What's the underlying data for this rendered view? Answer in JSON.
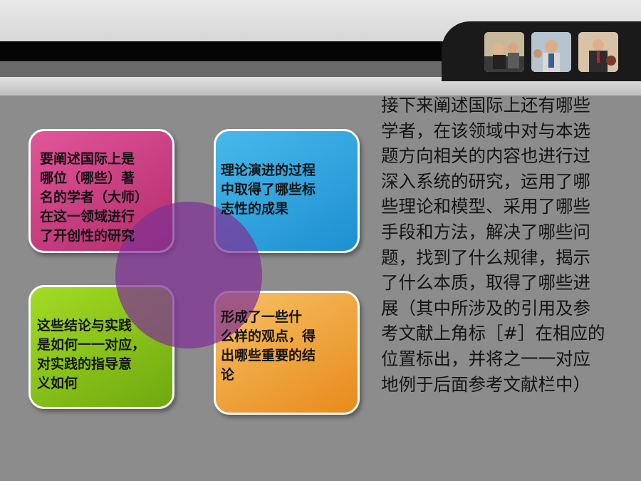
{
  "header": {
    "photos": [
      {
        "name": "business-meeting-photo-1"
      },
      {
        "name": "business-meeting-photo-2"
      },
      {
        "name": "business-meeting-photo-3"
      }
    ]
  },
  "cards": {
    "pink": "要阐述国际上是\n哪位（哪些）著\n名的学者（大师）\n在这一领域进行\n了开创性的研究",
    "blue": "理论演进的过程\n中取得了哪些标\n志性的成果",
    "green": "这些结论与实践\n是如何一一对应，\n对实践的指导意\n义如何",
    "orange": "    形成了一些什\n么样的观点，得\n出哪些重要的结\n论"
  },
  "body_text": "接下来阐述国际上还有哪些\n学者，在该领域中对与本选\n题方向相关的内容也进行过\n深入系统的研究，运用了哪\n些理论和模型、采用了哪些\n手段和方法，解决了哪些问\n题，找到了什么规律，揭示\n了什么本质，取得了哪些进\n展（其中所涉及的引用及参\n考文献上角标［#］在相应的\n位置标出，并将之一一对应\n地例于后面参考文献栏中）",
  "colors": {
    "background": "#8c8c8c",
    "pink": "#d84a8e",
    "blue": "#2fa6e0",
    "green": "#8cc51b",
    "orange": "#f0a33d",
    "circle": "#803096"
  }
}
